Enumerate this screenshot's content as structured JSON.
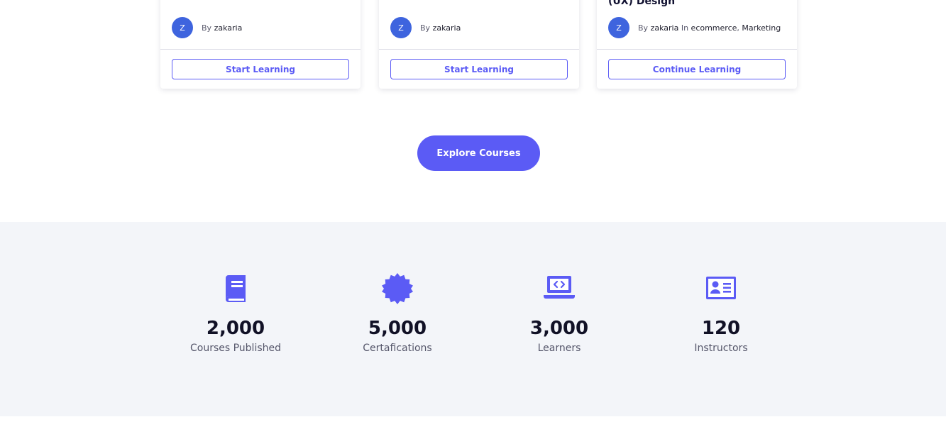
{
  "colors": {
    "accent": "#5b5bf5",
    "avatar": "#3e64de",
    "stats_background": "#f3f5f9"
  },
  "cards": [
    {
      "title": "",
      "avatar_letter": "Z",
      "by_label": "By",
      "author": "zakaria",
      "in_label": "",
      "categories": [],
      "button_label": "Start Learning"
    },
    {
      "title": "",
      "avatar_letter": "Z",
      "by_label": "By",
      "author": "zakaria",
      "in_label": "",
      "categories": [],
      "button_label": "Start Learning"
    },
    {
      "title": "(UX) Design",
      "avatar_letter": "Z",
      "by_label": "By",
      "author": "zakaria",
      "in_label": "In",
      "categories": [
        "ecommerce",
        "Marketing"
      ],
      "button_label": "Continue Learning"
    }
  ],
  "explore_button": {
    "label": "Explore Courses"
  },
  "stats": [
    {
      "icon": "book-icon",
      "number": "2,000",
      "label": "Courses Published"
    },
    {
      "icon": "badge-icon",
      "number": "5,000",
      "label": "Certafications"
    },
    {
      "icon": "laptop-code-icon",
      "number": "3,000",
      "label": "Learners"
    },
    {
      "icon": "id-card-icon",
      "number": "120",
      "label": "Instructors"
    }
  ]
}
